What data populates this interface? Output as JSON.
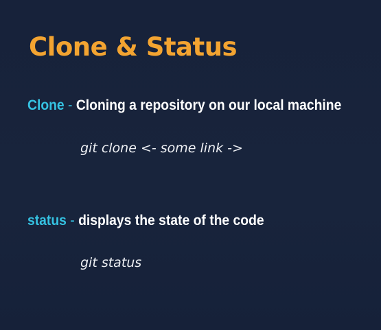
{
  "slide": {
    "title": "Clone & Status",
    "items": [
      {
        "keyword": "Clone",
        "separator": " - ",
        "description": "Cloning a repository on our local machine",
        "command": "git clone <- some link ->"
      },
      {
        "keyword": "status",
        "separator": " - ",
        "description": "displays the state of the code",
        "command": "git status"
      }
    ]
  },
  "colors": {
    "background": "#17223a",
    "title": "#f3a431",
    "keyword": "#35c2e2",
    "text": "#ffffff"
  }
}
